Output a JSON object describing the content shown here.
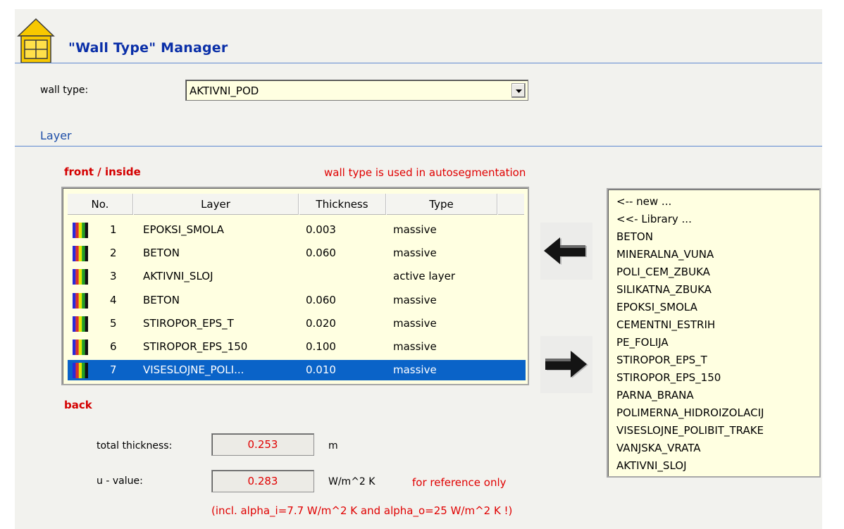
{
  "header": {
    "title": "\"Wall Type\" Manager",
    "icon": "house-icon"
  },
  "wall_type": {
    "label": "wall type:",
    "value": "AKTIVNI_POD"
  },
  "layer_section": {
    "label": "Layer"
  },
  "front_label": "front / inside",
  "back_label": "back",
  "autoseg_note": "wall type is used in autosegmentation",
  "table": {
    "columns": [
      "No.",
      "Layer",
      "Thickness",
      "Type"
    ],
    "rows": [
      {
        "no": "1",
        "layer": "EPOKSI_SMOLA",
        "thickness": "0.003",
        "type": "massive"
      },
      {
        "no": "2",
        "layer": "BETON",
        "thickness": "0.060",
        "type": "massive"
      },
      {
        "no": "3",
        "layer": "AKTIVNI_SLOJ",
        "thickness": "",
        "type": "active layer"
      },
      {
        "no": "4",
        "layer": "BETON",
        "thickness": "0.060",
        "type": "massive"
      },
      {
        "no": "5",
        "layer": "STIROPOR_EPS_T",
        "thickness": "0.020",
        "type": "massive"
      },
      {
        "no": "6",
        "layer": "STIROPOR_EPS_150",
        "thickness": "0.100",
        "type": "massive"
      },
      {
        "no": "7",
        "layer": "VISESLOJNE_POLI...",
        "thickness": "0.010",
        "type": "massive"
      }
    ],
    "selected_row": 7
  },
  "library": {
    "items": [
      "<-- new ...",
      "<<- Library ...",
      "BETON",
      "MINERALNA_VUNA",
      "POLI_CEM_ZBUKA",
      "SILIKATNA_ZBUKA",
      "EPOKSI_SMOLA",
      "CEMENTNI_ESTRIH",
      "PE_FOLIJA",
      "STIROPOR_EPS_T",
      "STIROPOR_EPS_150",
      "PARNA_BRANA",
      "POLIMERNA_HIDROIZOLACIJ",
      "VISESLOJNE_POLIBIT_TRAKE",
      "VANJSKA_VRATA",
      "AKTIVNI_SLOJ"
    ]
  },
  "totals": {
    "thickness_label": "total thickness:",
    "thickness_value": "0.253",
    "thickness_unit": "m",
    "u_label": "u - value:",
    "u_value": "0.283",
    "u_unit": "W/m^2 K",
    "reference_note": "for reference only",
    "alpha_note": "(incl. alpha_i=7.7 W/m^2 K and alpha_o=25 W/m^2 K !)"
  },
  "colors": {
    "title": "#0a2fa8",
    "accent_red": "#e00000",
    "selection": "#0a63c8",
    "field_bg": "#ffffe1"
  }
}
